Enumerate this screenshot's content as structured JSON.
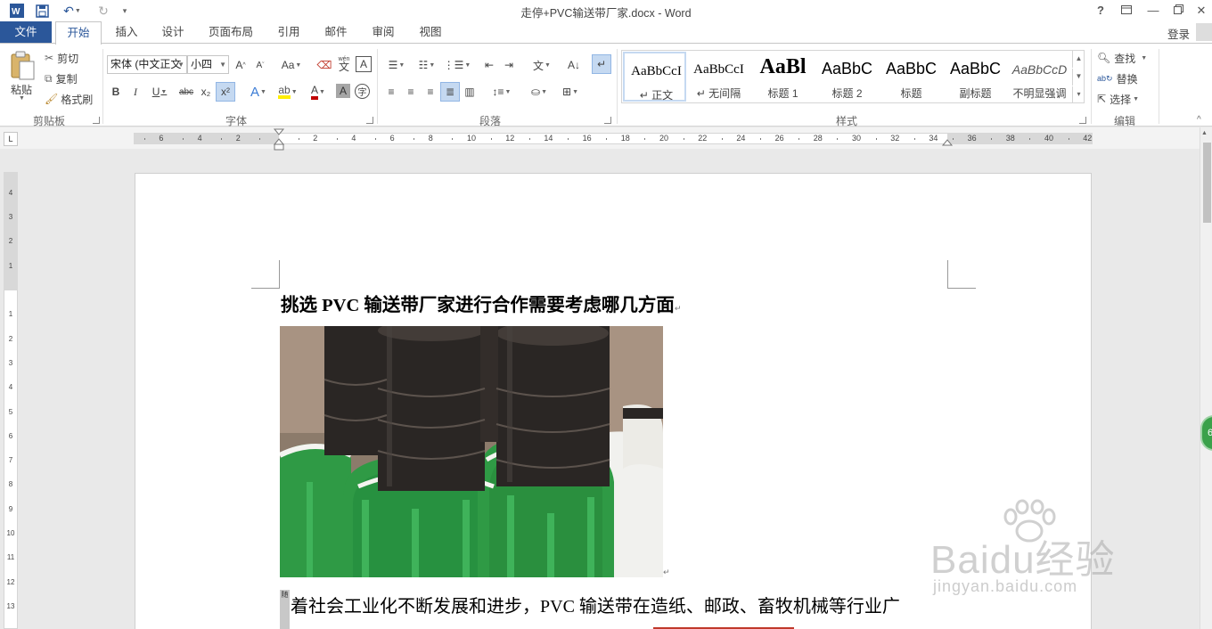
{
  "app": {
    "window_title": "走停+PVC输送带厂家.docx - Word",
    "login_label": "登录",
    "help_label": "?"
  },
  "tabs": {
    "file": "文件",
    "home": "开始",
    "others": [
      "插入",
      "设计",
      "页面布局",
      "引用",
      "邮件",
      "审阅",
      "视图"
    ]
  },
  "ribbon": {
    "clipboard": {
      "paste": "粘贴",
      "cut": "剪切",
      "copy": "复制",
      "format_painter": "格式刷",
      "group_label": "剪贴板"
    },
    "font": {
      "font_name": "宋体 (中文正文",
      "font_size": "小四",
      "change_case": "Aa",
      "bold": "B",
      "italic": "I",
      "underline": "U",
      "strikethrough": "abc",
      "subscript": "x₂",
      "superscript": "x²",
      "text_effect": "A",
      "font_color": "A",
      "char_shading": "A",
      "phonetic": "wén",
      "enclosed": "字",
      "group_label": "字体"
    },
    "paragraph": {
      "group_label": "段落"
    },
    "styles": {
      "items": [
        {
          "sample": "AaBbCcI",
          "name": "↵ 正文"
        },
        {
          "sample": "AaBbCcI",
          "name": "↵ 无间隔"
        },
        {
          "sample": "AaBl",
          "name": "标题 1"
        },
        {
          "sample": "AaBbC",
          "name": "标题 2"
        },
        {
          "sample": "AaBbC",
          "name": "标题"
        },
        {
          "sample": "AaBbC",
          "name": "副标题"
        },
        {
          "sample": "AaBbCcD",
          "name": "不明显强调"
        }
      ],
      "group_label": "样式"
    },
    "editing": {
      "find": "查找",
      "replace": "替换",
      "select": "选择",
      "group_label": "编辑"
    }
  },
  "ruler": {
    "corner": "L",
    "h_numbers": [
      "6",
      "4",
      "2",
      "2",
      "4",
      "6",
      "8",
      "10",
      "12",
      "14",
      "16",
      "18",
      "20",
      "22",
      "24",
      "26",
      "28",
      "30",
      "32",
      "34",
      "36",
      "38",
      "40",
      "42"
    ],
    "v_numbers": [
      "4",
      "3",
      "2",
      "1",
      "1",
      "2",
      "3",
      "4",
      "5",
      "6",
      "7",
      "8",
      "9",
      "10",
      "11",
      "12",
      "13"
    ]
  },
  "document": {
    "title": "挑选 PVC 输送带厂家进行合作需要考虑哪几方面",
    "body_line": "着社会工业化不断发展和进步，PVC 输送带在造纸、邮政、畜牧机械等行业广",
    "selection_mark": "随",
    "paragraph_mark": "↵",
    "image_subject": "rolls of green and dark PVC conveyor belts"
  },
  "watermark": {
    "brand": "Baidu经验",
    "url": "jingyan.baidu.com"
  },
  "side_badge": "6",
  "colors": {
    "accent": "#2b579a",
    "belt_green": "#2f9a45",
    "belt_dark": "#2a2624",
    "badge_green": "#3aa14a"
  }
}
